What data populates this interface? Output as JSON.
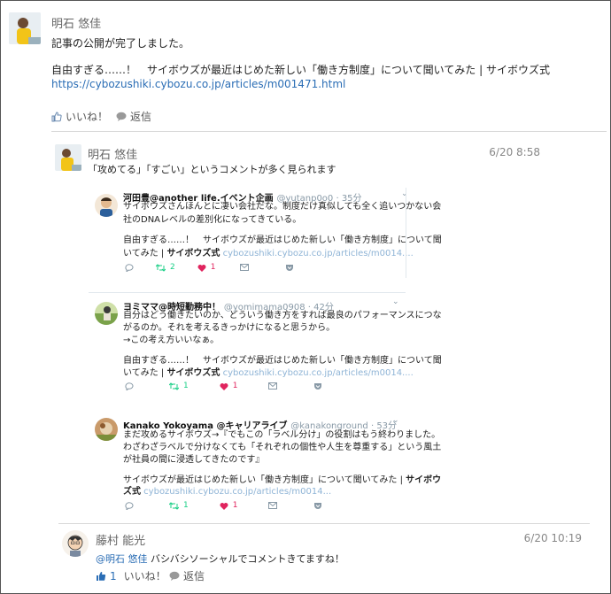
{
  "post": {
    "author": "明石 悠佳",
    "line1": "記事の公開が完了しました。",
    "line2": "自由すぎる……！　サイボウズが最近はじめた新しい「働き方制度」について聞いてみた | サイボウズ式",
    "url": "https://cybozushiki.cybozu.co.jp/articles/m001471.html",
    "like_label": "いいね！",
    "reply_label": "返信"
  },
  "comment1": {
    "author": "明石 悠佳",
    "time": "6/20 8:58",
    "text": "「攻めてる」「すごい」というコメントが多く見られます"
  },
  "tweets": [
    {
      "name": "河田豊@another life.イベント企画",
      "handle": "@yutanp0o0 · 35分",
      "lines": [
        "サイボウズさんほんとに凄い会社だな。制度だけ真似しても全く追いつかない会",
        "社のDNAレベルの差別化になってきている。"
      ],
      "quote_a": "自由すぎる……！　サイボウズが最近はじめた新しい「働き方制度」について聞",
      "quote_b": "いてみた | ",
      "quote_bold": "サイボウズ式",
      "quote_link": " cybozushiki.cybozu.co.jp/articles/m0014....",
      "retweets": "2",
      "likes": "1"
    },
    {
      "name": "ヨミママ@時短勤務中！",
      "handle": "@yomimama0908 · 42分",
      "lines": [
        "自分はどう働きたいのか、どういう働き方をすれば最良のパフォーマンスにつな",
        "がるのか。それを考えるきっかけになると思うから。",
        "→この考え方いいなぁ。"
      ],
      "quote_a": "自由すぎる……！　サイボウズが最近はじめた新しい「働き方制度」について聞",
      "quote_b": "いてみた | ",
      "quote_bold": "サイボウズ式",
      "quote_link": " cybozushiki.cybozu.co.jp/articles/m0014....",
      "retweets": "1",
      "likes": "1"
    },
    {
      "name": "Kanako Yokoyama @キャリアライブ",
      "handle": "@kanakonground · 53分",
      "lines": [
        "まだ攻めるサイボウズ→『でもこの「ラベル分け」の役割はもう終わりました。",
        "わざわざラベルで分けなくても「それぞれの個性や人生を尊重する」という風土",
        "が社員の間に浸透してきたのです』"
      ],
      "quote_a": "サイボウズが最近はじめた新しい「働き方制度」について聞いてみた | ",
      "quote_a_bold": "サイボウ",
      "quote_b": "",
      "quote_bold": "ズ式",
      "quote_link": " cybozushiki.cybozu.co.jp/articles/m0014...",
      "retweets": "1",
      "likes": "1"
    }
  ],
  "comment2": {
    "author": "藤村 能光",
    "time": "6/20 10:19",
    "mention": "@明石 悠佳",
    "text": " バシバシソーシャルでコメントきてますね！",
    "like_count": "1",
    "like_label": "いいね！",
    "reply_label": "返信"
  },
  "colors": {
    "link": "#2a6db5",
    "retweet": "#19cf86",
    "heart": "#e0245e",
    "twitter_muted": "#8899a6"
  }
}
